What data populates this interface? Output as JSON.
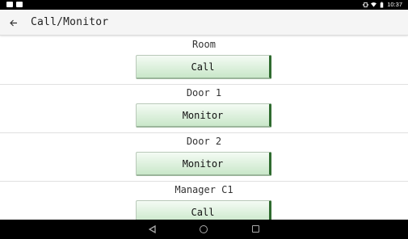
{
  "status_bar": {
    "time": "10:37",
    "icons": [
      "notification-icon",
      "message-icon",
      "vibrate-icon",
      "wifi-icon",
      "battery-icon"
    ]
  },
  "app_bar": {
    "back_icon": "arrow-back-icon",
    "title": "Call/Monitor"
  },
  "sections": [
    {
      "label": "Room",
      "button": "Call"
    },
    {
      "label": "Door 1",
      "button": "Monitor"
    },
    {
      "label": "Door 2",
      "button": "Monitor"
    },
    {
      "label": "Manager C1",
      "button": "Call"
    }
  ],
  "colors": {
    "button_gradient_top": "#f4fbf4",
    "button_gradient_bottom": "#c9e7c9",
    "button_accent": "#2f6b2f"
  },
  "nav_bar": {
    "icons": [
      "nav-back-icon",
      "nav-home-icon",
      "nav-recent-apps-icon"
    ]
  }
}
